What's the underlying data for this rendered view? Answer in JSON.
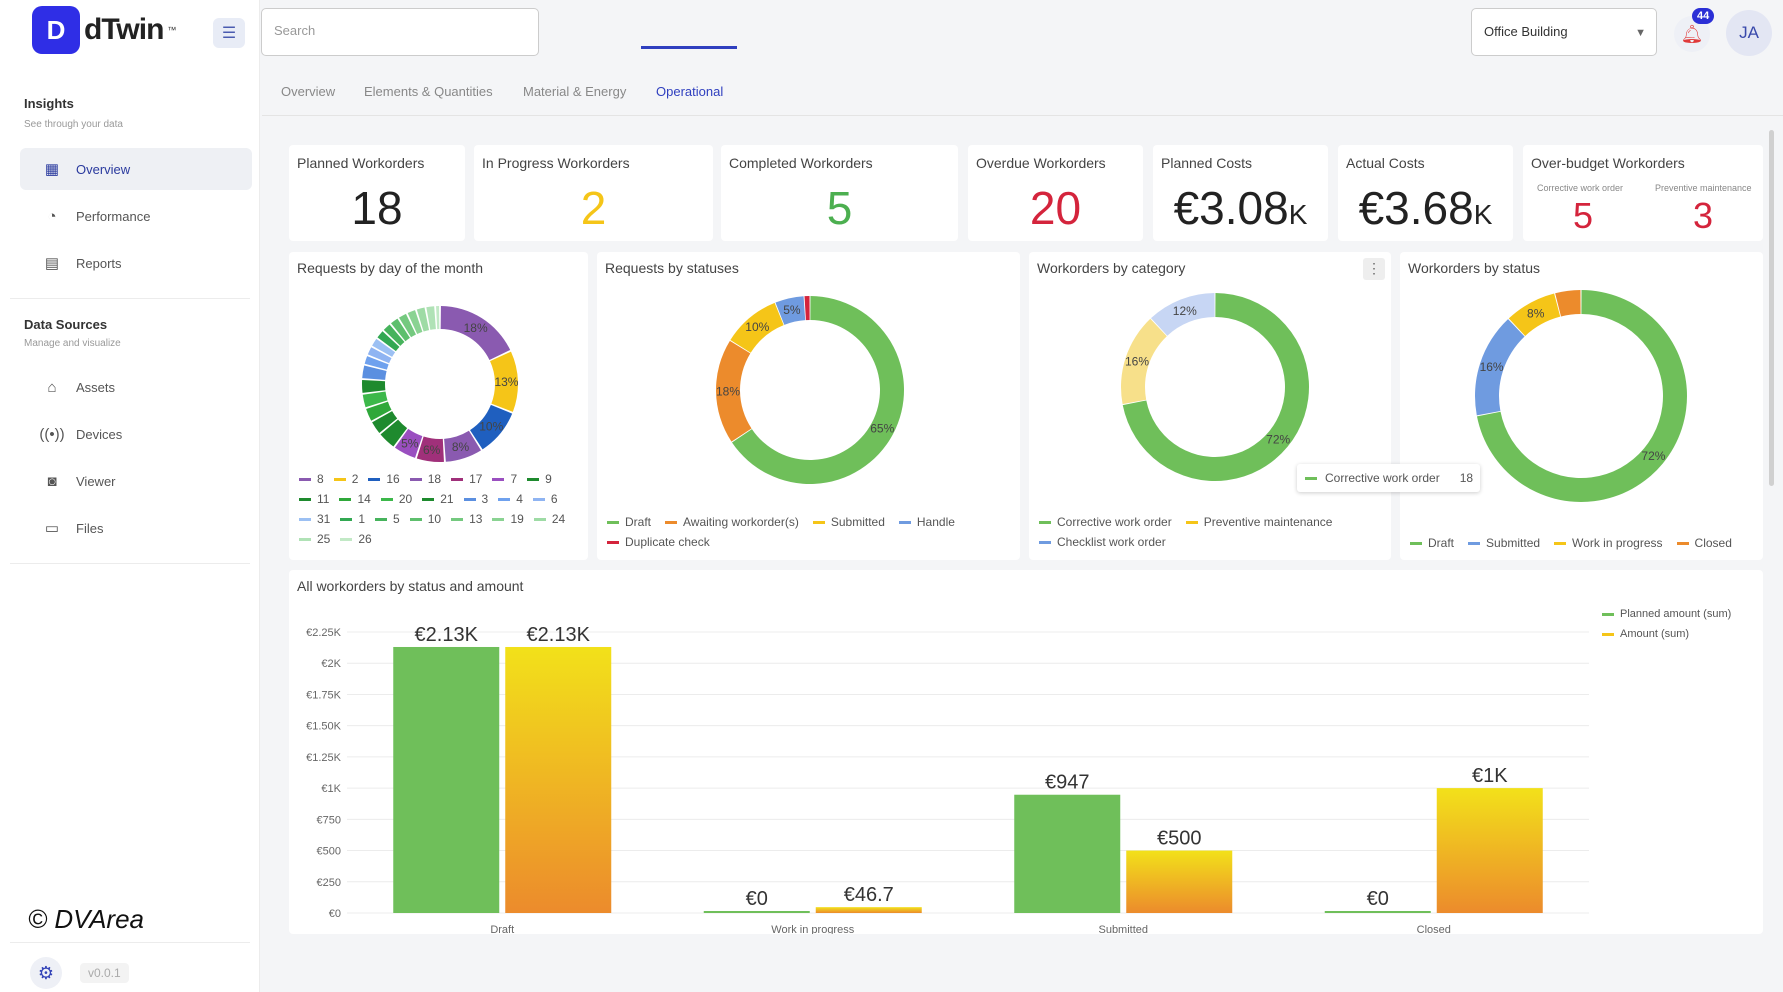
{
  "app": {
    "logo_text": "dTwin",
    "logo_tm": "™",
    "logo_mark": "D"
  },
  "header": {
    "search_placeholder": "Search",
    "building": "Office Building",
    "notifications": "44",
    "avatar": "JA"
  },
  "sidebar": {
    "insights_title": "Insights",
    "insights_sub": "See through your data",
    "insights_items": [
      {
        "label": "Overview"
      },
      {
        "label": "Performance"
      },
      {
        "label": "Reports"
      }
    ],
    "sources_title": "Data Sources",
    "sources_sub": "Manage and visualize",
    "sources_items": [
      {
        "label": "Assets"
      },
      {
        "label": "Devices"
      },
      {
        "label": "Viewer"
      },
      {
        "label": "Files"
      }
    ],
    "copyright": "© DVArea",
    "version": "v0.0.1"
  },
  "tabs": [
    "Overview",
    "Elements & Quantities",
    "Material & Energy",
    "Operational"
  ],
  "kpis": [
    {
      "title": "Planned Workorders",
      "value": "18",
      "color": "#222222"
    },
    {
      "title": "In Progress Workorders",
      "value": "2",
      "color": "#f5c518"
    },
    {
      "title": "Completed Workorders",
      "value": "5",
      "color": "#4caf50"
    },
    {
      "title": "Overdue Workorders",
      "value": "20",
      "color": "#d4243c"
    },
    {
      "title": "Planned Costs",
      "value": "€3.08",
      "suffix": "K",
      "color": "#222222"
    },
    {
      "title": "Actual Costs",
      "value": "€3.68",
      "suffix": "K",
      "color": "#222222"
    }
  ],
  "overbudget": {
    "title": "Over-budget Workorders",
    "left_label": "Corrective work order",
    "left_value": "5",
    "right_label": "Preventive maintenance",
    "right_value": "3"
  },
  "charts": {
    "requests_by_day": {
      "title": "Requests by day of the month",
      "labels": [
        "18%",
        "13%",
        "10%",
        "8%",
        "6%",
        "5%"
      ],
      "legend": [
        "8",
        "2",
        "16",
        "18",
        "17",
        "7",
        "9",
        "11",
        "14",
        "20",
        "21",
        "3",
        "4",
        "6",
        "31",
        "1",
        "5",
        "10",
        "13",
        "19",
        "24",
        "25",
        "26"
      ]
    },
    "requests_by_status": {
      "title": "Requests by statuses",
      "labels": [
        "65%",
        "18%",
        "10%",
        "5%"
      ],
      "legend": [
        "Draft",
        "Awaiting workorder(s)",
        "Submitted",
        "Handle",
        "Duplicate check"
      ]
    },
    "workorders_by_category": {
      "title": "Workorders by category",
      "labels": [
        "72%",
        "16%",
        "12%"
      ],
      "legend": [
        "Corrective work order",
        "Preventive maintenance",
        "Checklist work order"
      ],
      "tooltip_label": "Corrective work order",
      "tooltip_value": "18"
    },
    "workorders_by_status": {
      "title": "Workorders by status",
      "labels": [
        "72%",
        "16%",
        "8%"
      ],
      "legend": [
        "Draft",
        "Submitted",
        "Work in progress",
        "Closed"
      ]
    },
    "bar": {
      "title": "All workorders by status and amount",
      "legend": [
        "Planned amount (sum)",
        "Amount (sum)"
      ]
    }
  },
  "chart_data": [
    {
      "type": "pie",
      "title": "Requests by day of the month",
      "categories": [
        "8",
        "2",
        "16",
        "18",
        "17",
        "7",
        "9",
        "11",
        "14",
        "20",
        "21",
        "3",
        "4",
        "6",
        "31",
        "1",
        "5",
        "10",
        "13",
        "19",
        "24",
        "25",
        "26"
      ],
      "values": [
        18,
        13,
        10,
        8,
        6,
        5,
        4,
        3,
        3,
        3,
        3,
        3,
        2,
        2,
        2,
        2,
        2,
        2,
        2,
        2,
        2,
        2,
        1
      ]
    },
    {
      "type": "pie",
      "title": "Requests by statuses",
      "categories": [
        "Draft",
        "Awaiting workorder(s)",
        "Submitted",
        "Handle",
        "Duplicate check"
      ],
      "values": [
        65,
        18,
        10,
        5,
        1
      ]
    },
    {
      "type": "pie",
      "title": "Workorders by category",
      "categories": [
        "Corrective work order",
        "Preventive maintenance",
        "Checklist work order"
      ],
      "values": [
        72,
        16,
        12
      ]
    },
    {
      "type": "pie",
      "title": "Workorders by status",
      "categories": [
        "Draft",
        "Submitted",
        "Work in progress",
        "Closed"
      ],
      "values": [
        72,
        16,
        8,
        4
      ]
    },
    {
      "type": "bar",
      "title": "All workorders by status and amount",
      "categories": [
        "Draft",
        "Work in progress",
        "Submitted",
        "Closed"
      ],
      "series": [
        {
          "name": "Planned amount (sum)",
          "values": [
            2130,
            0,
            947,
            0
          ],
          "labels": [
            "€2.13K",
            "€0",
            "€947",
            "€0"
          ]
        },
        {
          "name": "Amount (sum)",
          "values": [
            2130,
            46.7,
            500,
            1000
          ],
          "labels": [
            "€2.13K",
            "€46.7",
            "€500",
            "€1K"
          ]
        }
      ],
      "yticks": [
        "€0",
        "€250",
        "€500",
        "€750",
        "€1K",
        "€1.25K",
        "€1.50K",
        "€1.75K",
        "€2K",
        "€2.25K"
      ],
      "ylim": [
        0,
        2250
      ]
    }
  ],
  "colors": {
    "green": "#6fbf5a",
    "blue": "#6f9be0",
    "yellow": "#f5c518",
    "orange": "#ec8b2c",
    "red": "#d4243c",
    "purple": "#8a5ab0",
    "lightyellow": "#f7e08a",
    "lightblue": "#c7d6f4",
    "accent": "#2f3fbf"
  }
}
